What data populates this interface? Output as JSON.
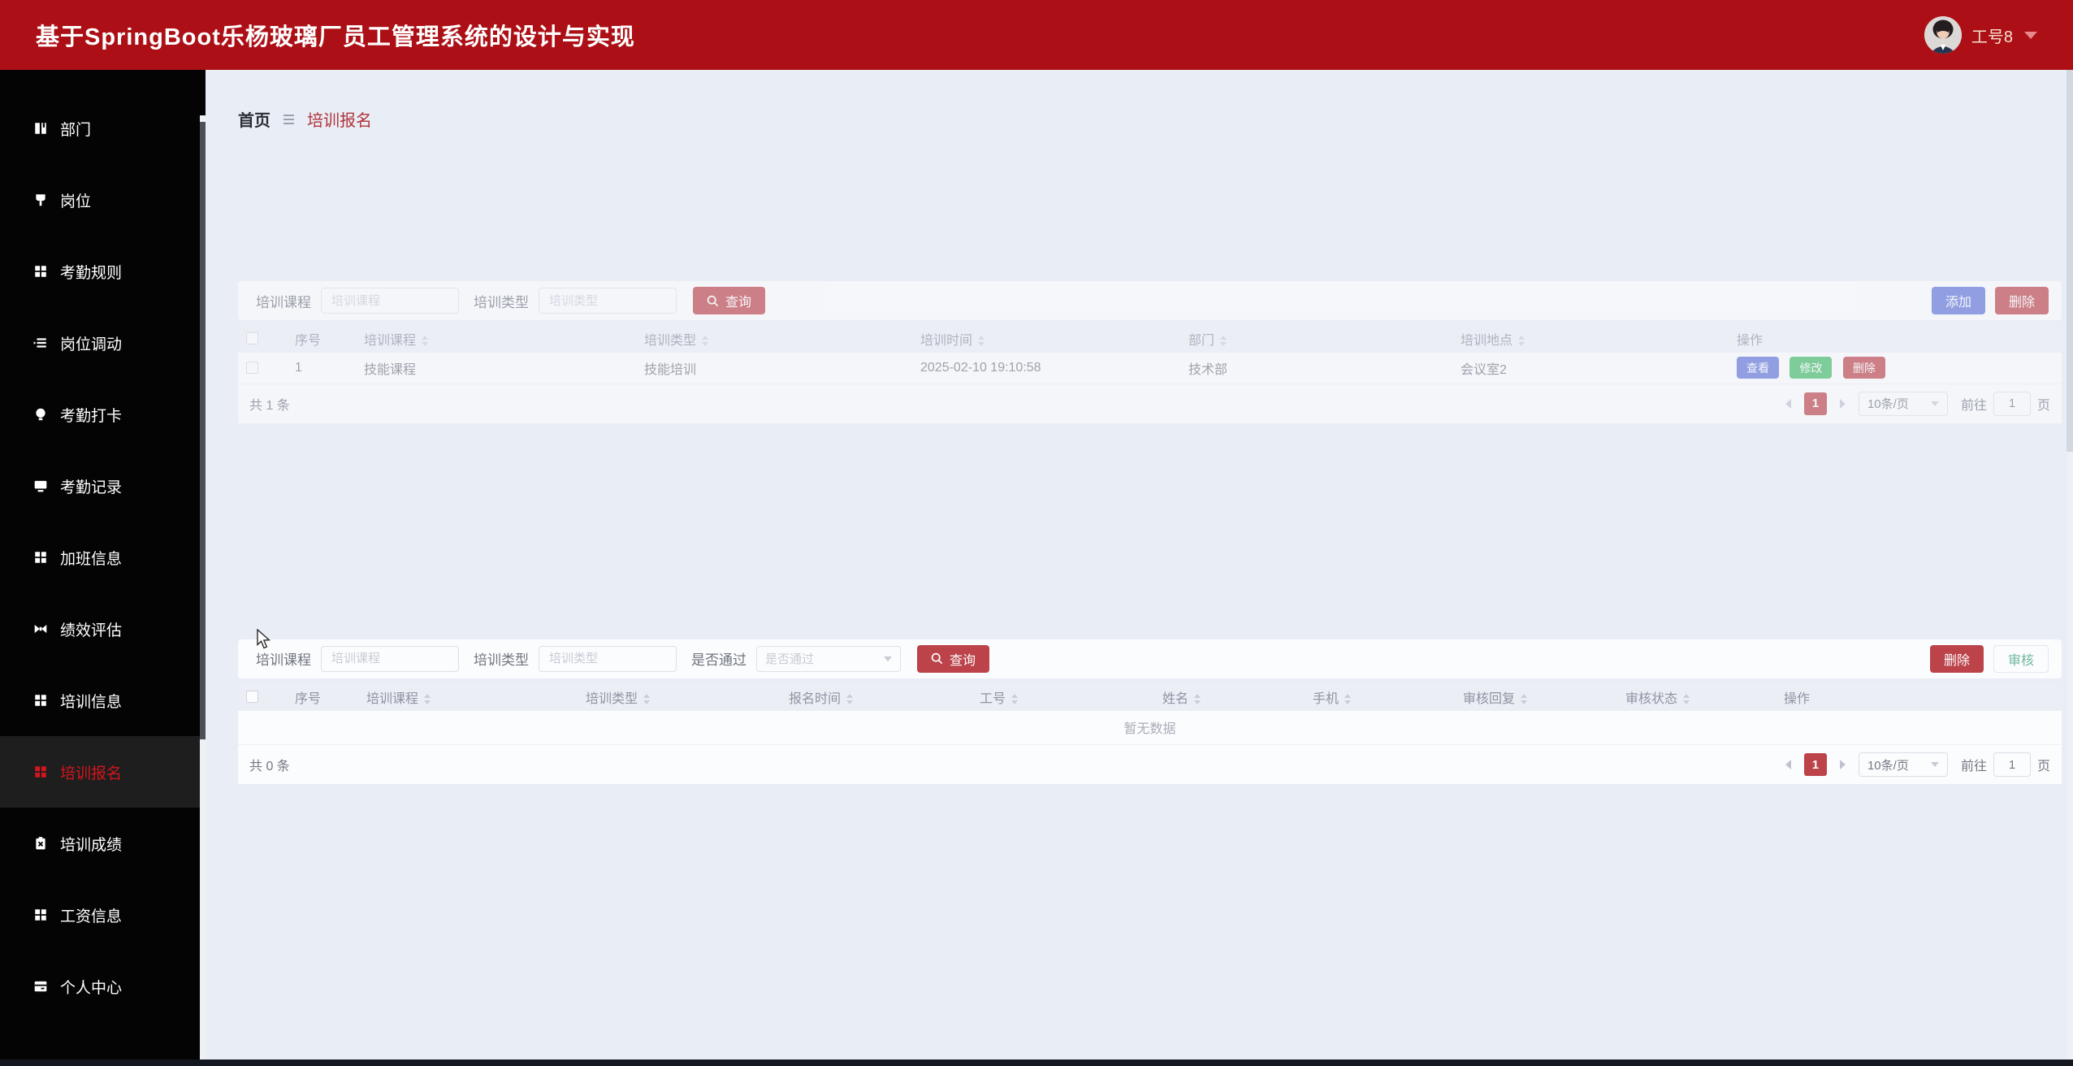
{
  "header": {
    "title": "基于SpringBoot乐杨玻璃厂员工管理系统的设计与实现",
    "user_name": "工号8"
  },
  "sidebar": {
    "items": [
      {
        "label": "部门",
        "icon": "notebook-icon"
      },
      {
        "label": "岗位",
        "icon": "brush-icon"
      },
      {
        "label": "考勤规则",
        "icon": "grid-icon"
      },
      {
        "label": "岗位调动",
        "icon": "list-icon"
      },
      {
        "label": "考勤打卡",
        "icon": "bulb-icon"
      },
      {
        "label": "考勤记录",
        "icon": "monitor-icon"
      },
      {
        "label": "加班信息",
        "icon": "grid-icon"
      },
      {
        "label": "绩效评估",
        "icon": "film-icon"
      },
      {
        "label": "培训信息",
        "icon": "grid-icon"
      },
      {
        "label": "培训报名",
        "icon": "grid-icon",
        "active": true
      },
      {
        "label": "培训成绩",
        "icon": "clipboard-icon"
      },
      {
        "label": "工资信息",
        "icon": "grid-icon"
      },
      {
        "label": "个人中心",
        "icon": "window-icon"
      }
    ]
  },
  "breadcrumb": {
    "home": "首页",
    "current": "培训报名"
  },
  "panel1": {
    "search": {
      "course_label": "培训课程",
      "course_placeholder": "培训课程",
      "type_label": "培训类型",
      "type_placeholder": "培训类型",
      "query_label": "查询"
    },
    "actions": {
      "add_label": "添加",
      "delete_label": "删除"
    },
    "table": {
      "columns": [
        "序号",
        "培训课程",
        "培训类型",
        "培训时间",
        "部门",
        "培训地点",
        "操作"
      ],
      "row": {
        "index": "1",
        "course": "技能课程",
        "type": "技能培训",
        "time": "2025-02-10 19:10:58",
        "dept": "技术部",
        "place": "会议室2"
      },
      "row_actions": {
        "view": "查看",
        "edit": "修改",
        "delete": "删除"
      }
    },
    "pagination": {
      "total": "共 1 条",
      "page": "1",
      "size": "10条/页",
      "goto_label": "前往",
      "goto_value": "1",
      "unit": "页"
    }
  },
  "panel2": {
    "search": {
      "course_label": "培训课程",
      "course_placeholder": "培训课程",
      "type_label": "培训类型",
      "type_placeholder": "培训类型",
      "pass_label": "是否通过",
      "pass_placeholder": "是否通过",
      "query_label": "查询"
    },
    "actions": {
      "delete_label": "删除",
      "audit_label": "审核"
    },
    "table": {
      "columns": [
        "序号",
        "培训课程",
        "培训类型",
        "报名时间",
        "工号",
        "姓名",
        "手机",
        "审核回复",
        "审核状态",
        "操作"
      ],
      "empty_text": "暂无数据"
    },
    "pagination": {
      "total": "共 0 条",
      "page": "1",
      "size": "10条/页",
      "goto_label": "前往",
      "goto_value": "1",
      "unit": "页"
    }
  },
  "colors": {
    "header_bg": "#ac1016",
    "theme_red": "#b5262c",
    "primary_blue": "#4a61d2",
    "success_green": "#27b250",
    "audit_teal": "#5aaf91",
    "sidebar_active_red": "#d3151d",
    "content_bg": "#e9edf6"
  }
}
